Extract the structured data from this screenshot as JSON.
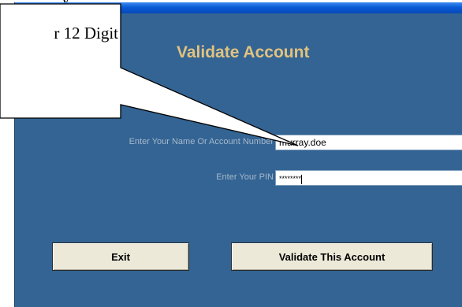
{
  "document": {
    "fragment_text": "y"
  },
  "window": {
    "panel_title": "Validate Account",
    "title_bar_color": "#0a5ad6",
    "background_color": "#336493",
    "title_color": "#e2c27f"
  },
  "form": {
    "name_label": "Enter Your Name Or Account Number",
    "name_value": "murray.doe",
    "pin_label": "Enter Your PIN",
    "pin_value": "********"
  },
  "buttons": {
    "exit_label": "Exit",
    "validate_label": "Validate This Account"
  },
  "callout": {
    "text": "r 12 Digit"
  }
}
